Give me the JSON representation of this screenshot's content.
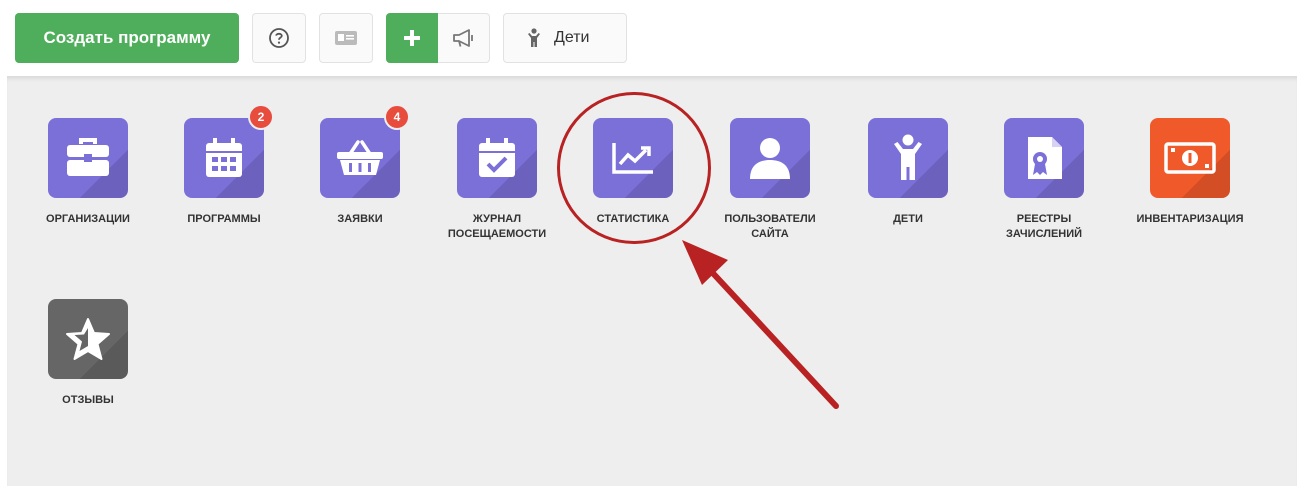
{
  "toolbar": {
    "create_program_label": "Создать программу",
    "kids_label": "Дети"
  },
  "tiles": [
    {
      "label_line1": "ОРГАНИЗАЦИИ",
      "label_line2": "",
      "icon": "briefcase-icon",
      "badge": ""
    },
    {
      "label_line1": "ПРОГРАММЫ",
      "label_line2": "",
      "icon": "calendar-icon",
      "badge": "2"
    },
    {
      "label_line1": "ЗАЯВКИ",
      "label_line2": "",
      "icon": "basket-icon",
      "badge": "4"
    },
    {
      "label_line1": "ЖУРНАЛ",
      "label_line2": "ПОСЕЩАЕМОСТИ",
      "icon": "calendar-check-icon",
      "badge": ""
    },
    {
      "label_line1": "СТАТИСТИКА",
      "label_line2": "",
      "icon": "chart-line-icon",
      "badge": ""
    },
    {
      "label_line1": "ПОЛЬЗОВАТЕЛИ",
      "label_line2": "САЙТА",
      "icon": "user-icon",
      "badge": ""
    },
    {
      "label_line1": "ДЕТИ",
      "label_line2": "",
      "icon": "child-icon",
      "badge": ""
    },
    {
      "label_line1": "РЕЕСТРЫ",
      "label_line2": "ЗАЧИСЛЕНИЙ",
      "icon": "certificate-icon",
      "badge": ""
    },
    {
      "label_line1": "ИНВЕНТАРИЗАЦИЯ",
      "label_line2": "",
      "icon": "money-icon",
      "badge": ""
    },
    {
      "label_line1": "ОТЗЫВЫ",
      "label_line2": "",
      "icon": "star-icon",
      "badge": ""
    }
  ],
  "colors": {
    "green": "#4fae5b",
    "tile_purple": "#7b6fd8",
    "tile_orange": "#f0592a",
    "tile_gray": "#666666",
    "badge_red": "#e84c3d",
    "annotation_red": "#b82222"
  }
}
